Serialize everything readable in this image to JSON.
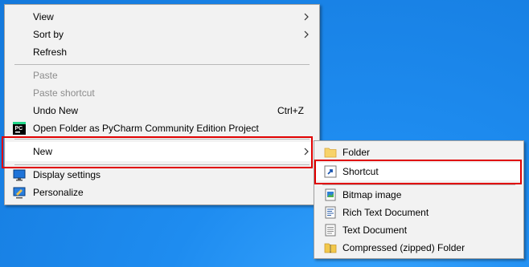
{
  "colors": {
    "desktop": "#1479dc",
    "menu_background": "#f2f2f2",
    "highlight": "#ffffff",
    "annotation_red": "#e00000",
    "disabled_text": "#8c8c8c"
  },
  "context_menu": {
    "items": [
      {
        "label": "View",
        "has_submenu": true,
        "enabled": true
      },
      {
        "label": "Sort by",
        "has_submenu": true,
        "enabled": true
      },
      {
        "label": "Refresh",
        "enabled": true
      },
      {
        "label": "Paste",
        "enabled": false
      },
      {
        "label": "Paste shortcut",
        "enabled": false
      },
      {
        "label": "Undo New",
        "shortcut": "Ctrl+Z",
        "enabled": true
      },
      {
        "label": "Open Folder as PyCharm Community Edition Project",
        "icon": "pycharm-icon",
        "enabled": true
      },
      {
        "label": "New",
        "has_submenu": true,
        "enabled": true,
        "highlighted": true
      },
      {
        "label": "Display settings",
        "icon": "display-settings-icon",
        "enabled": true
      },
      {
        "label": "Personalize",
        "icon": "personalize-icon",
        "enabled": true
      }
    ]
  },
  "new_submenu": {
    "items": [
      {
        "label": "Folder",
        "icon": "folder-icon"
      },
      {
        "label": "Shortcut",
        "icon": "shortcut-icon",
        "highlighted": true
      },
      {
        "label": "Bitmap image",
        "icon": "bitmap-icon"
      },
      {
        "label": "Rich Text Document",
        "icon": "rich-text-icon"
      },
      {
        "label": "Text Document",
        "icon": "text-document-icon"
      },
      {
        "label": "Compressed (zipped) Folder",
        "icon": "zip-folder-icon"
      }
    ]
  },
  "icons": {
    "pycharm_text": "PC"
  }
}
